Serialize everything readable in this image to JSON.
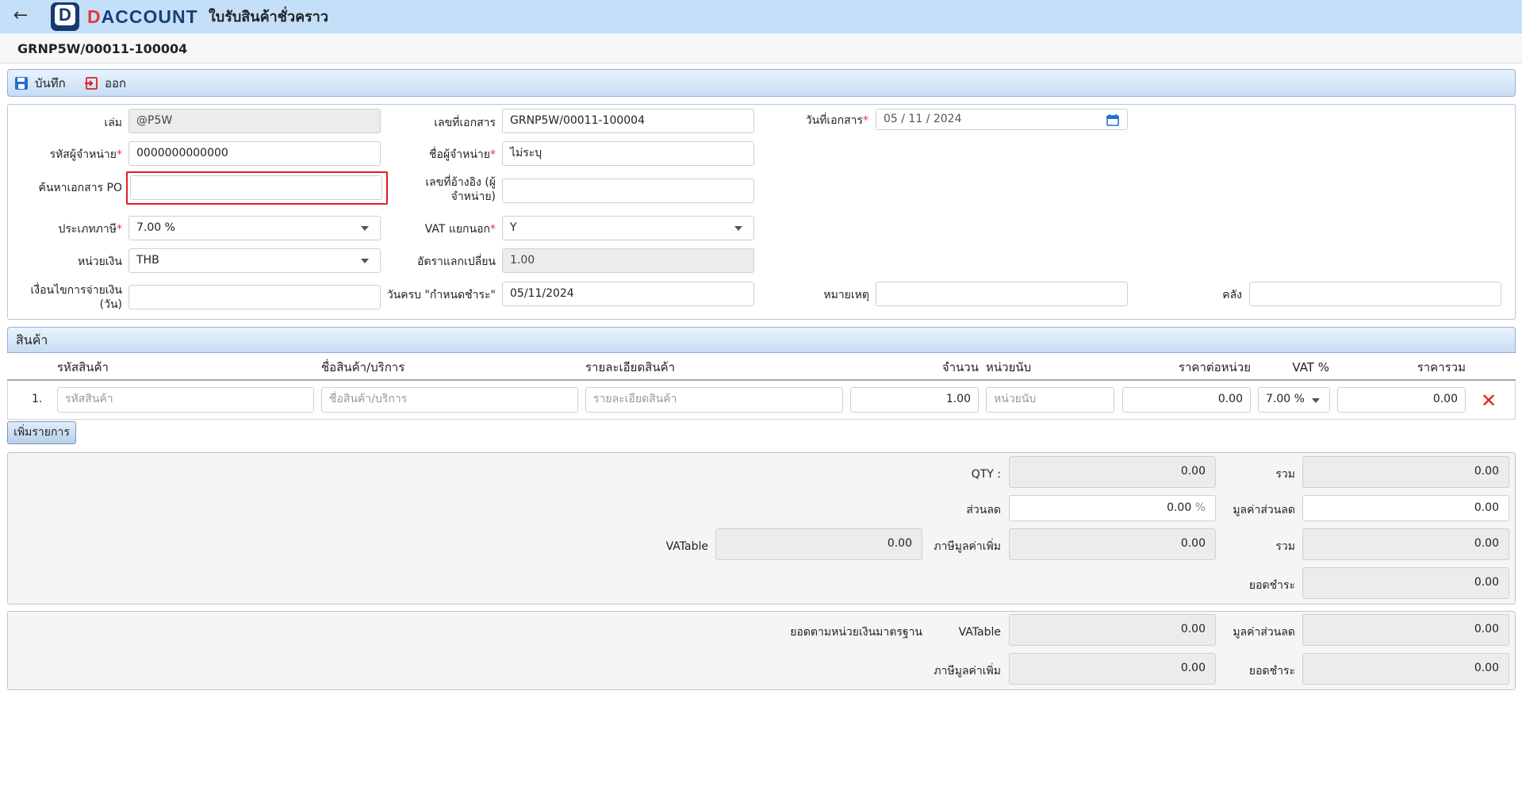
{
  "app": {
    "back_icon": "arrow-left-icon",
    "logo_letter": "D",
    "logo_text_first": "D",
    "logo_text_rest": "ACCOUNT",
    "page_title": "ใบรับสินค้าชั่วคราว"
  },
  "doc_number": "GRNP5W/00011-100004",
  "toolbar": {
    "save_label": "บันทึก",
    "exit_label": "ออก"
  },
  "form": {
    "book_label": "เล่ม",
    "book_value": "@P5W",
    "doc_no_label": "เลขที่เอกสาร",
    "doc_no_value": "GRNP5W/00011-100004",
    "doc_date_label": "วันที่เอกสาร",
    "doc_date_value": "05 / 11 /  2024",
    "vendor_code_label": "รหัสผู้จำหน่าย",
    "vendor_code_value": "0000000000000",
    "vendor_name_label": "ชื่อผู้จำหน่าย",
    "vendor_name_value": "ไม่ระบุ",
    "po_search_label": "ค้นหาเอกสาร PO",
    "po_search_value": "",
    "ref_no_label_1": "เลขที่อ้างอิง (ผู้",
    "ref_no_label_2": "จำหน่าย)",
    "ref_no_value": "",
    "tax_type_label": "ประเภทภาษี",
    "tax_type_value": "7.00 %",
    "vat_sep_label": "VAT แยกนอก",
    "vat_sep_value": "Y",
    "currency_label": "หน่วยเงิน",
    "currency_value": "THB",
    "rate_label": "อัตราแลกเปลี่ยน",
    "rate_value": "1.00",
    "pay_term_label_1": "เงื่อนไขการจ่ายเงิน",
    "pay_term_label_2": "(วัน)",
    "pay_term_value": "",
    "due_label": "วันครบ \"กำหนดชำระ\"",
    "due_value": "05/11/2024",
    "remark_label": "หมายเหตุ",
    "remark_value": "",
    "warehouse_label": "คลัง",
    "warehouse_value": ""
  },
  "products": {
    "section_title": "สินค้า",
    "columns": [
      "รหัสสินค้า",
      "ชื่อสินค้า/บริการ",
      "รายละเอียดสินค้า",
      "จำนวน",
      "หน่วยนับ",
      "ราคาต่อหน่วย",
      "VAT %",
      "ราคารวม"
    ],
    "rows": [
      {
        "index": "1.",
        "code_ph": "รหัสสินค้า",
        "name_ph": "ชื่อสินค้า/บริการ",
        "detail_ph": "รายละเอียดสินค้า",
        "qty": "1.00",
        "unit_ph": "หน่วยนับ",
        "price": "0.00",
        "vat": "7.00 %",
        "total": "0.00"
      }
    ],
    "add_label": "เพิ่มรายการ"
  },
  "totals": {
    "qty_label": "QTY :",
    "qty_value": "0.00",
    "sum_label": "รวม",
    "sum_value": "0.00",
    "discount_label": "ส่วนลด",
    "discount_value": "0.00",
    "discount_unit": "%",
    "discount_amt_label": "มูลค่าส่วนลด",
    "discount_amt_value": "0.00",
    "vatable_label": "VATable",
    "vatable_value": "0.00",
    "vat_label": "ภาษีมูลค่าเพิ่ม",
    "vat_value": "0.00",
    "sum2_label": "รวม",
    "sum2_value": "0.00",
    "pay_label": "ยอดชำระ",
    "pay_value": "0.00"
  },
  "standard": {
    "caption": "ยอดตามหน่วยเงินมาตรฐาน",
    "vatable_label": "VATable",
    "vatable_value": "0.00",
    "discount_amt_label": "มูลค่าส่วนลด",
    "discount_amt_value": "0.00",
    "vat_label": "ภาษีมูลค่าเพิ่ม",
    "vat_value": "0.00",
    "pay_label": "ยอดชำระ",
    "pay_value": "0.00"
  },
  "colors": {
    "topbar": "#c4e0f9",
    "accent_red": "#e53935",
    "brand_navy": "#1b3f77"
  }
}
